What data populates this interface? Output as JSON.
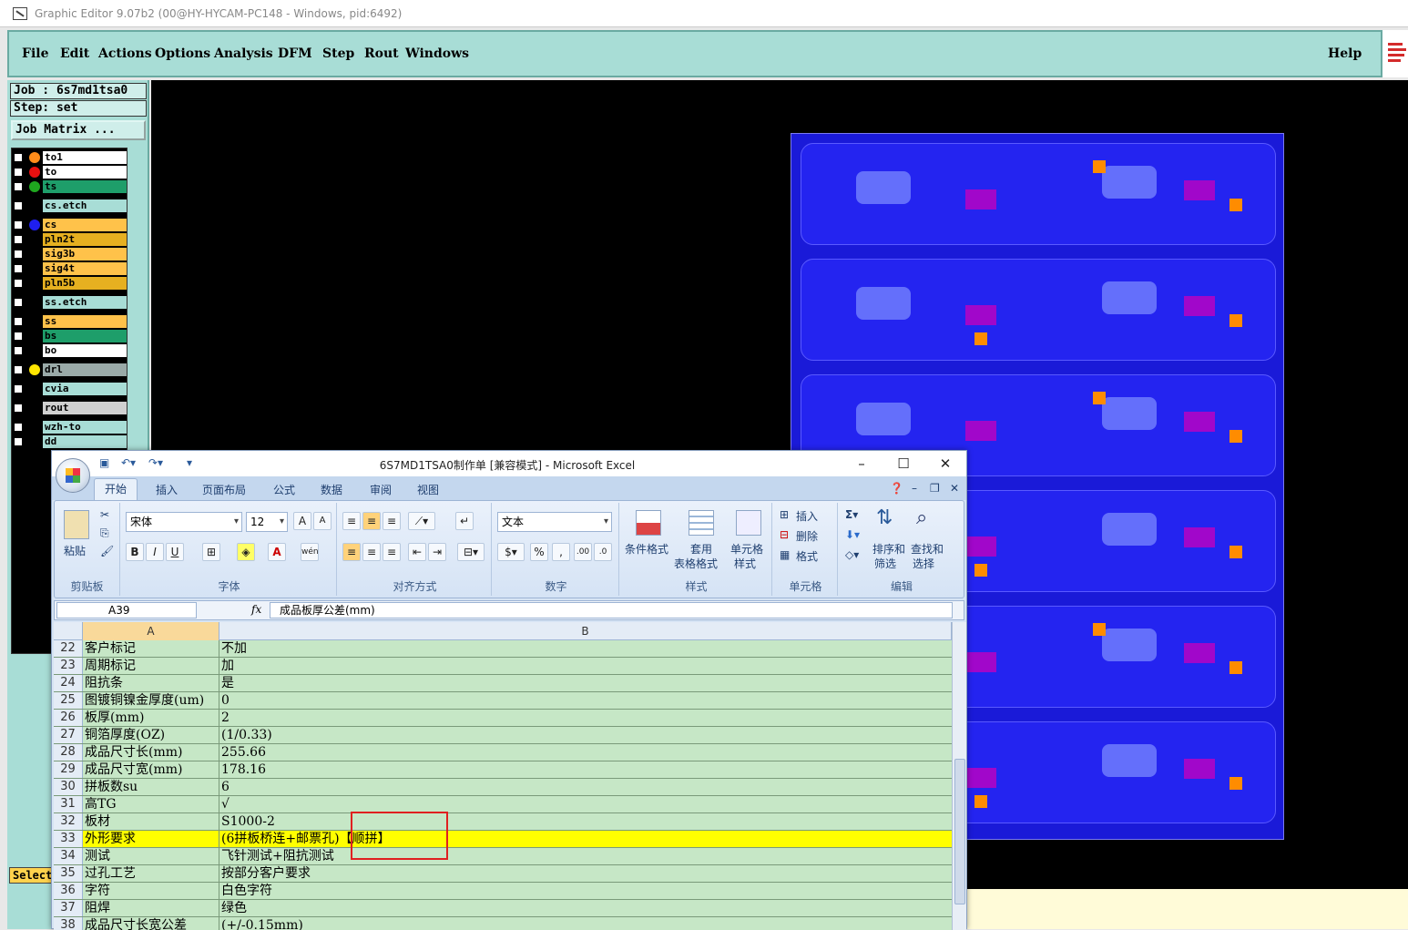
{
  "editor": {
    "title": "Graphic Editor 9.07b2 (00@HY-HYCAM-PC148 - Windows, pid:6492)",
    "menu": [
      "File",
      "Edit",
      "Actions",
      "Options",
      "Analysis",
      "DFM",
      "Step",
      "Rout",
      "Windows"
    ],
    "help": "Help",
    "job": "Job : 6s7md1tsa0",
    "step": "Step: set",
    "job_matrix": "Job Matrix ...",
    "select": "Select",
    "layers": [
      {
        "name": "to1",
        "dot": "#ff8c1a",
        "bg": "#ffffff"
      },
      {
        "name": "to",
        "dot": "#e81010",
        "bg": "#ffffff"
      },
      {
        "name": "ts",
        "dot": "#1fa81f",
        "bg": "#1e9e6a"
      },
      {
        "name": "cs.etch",
        "dot": "",
        "bg": "#a8ddd6"
      },
      {
        "name": "cs",
        "dot": "#1f1ff0",
        "bg": "#ffc24a"
      },
      {
        "name": "pln2t",
        "dot": "",
        "bg": "#e6b020"
      },
      {
        "name": "sig3b",
        "dot": "",
        "bg": "#ffc24a"
      },
      {
        "name": "sig4t",
        "dot": "",
        "bg": "#ffc24a"
      },
      {
        "name": "pln5b",
        "dot": "",
        "bg": "#e6b020"
      },
      {
        "name": "ss.etch",
        "dot": "",
        "bg": "#a8ddd6"
      },
      {
        "name": "ss",
        "dot": "",
        "bg": "#ffc24a"
      },
      {
        "name": "bs",
        "dot": "",
        "bg": "#1e9e6a"
      },
      {
        "name": "bo",
        "dot": "",
        "bg": "#ffffff"
      },
      {
        "name": "drl",
        "dot": "#ffe600",
        "bg": "#9aaaa8"
      },
      {
        "name": "cvia",
        "dot": "",
        "bg": "#a8ddd6"
      },
      {
        "name": "rout",
        "dot": "",
        "bg": "#d0d0d0"
      },
      {
        "name": "wzh-to",
        "dot": "",
        "bg": "#a8ddd6"
      },
      {
        "name": "dd",
        "dot": "",
        "bg": "#a8ddd6"
      }
    ],
    "colors": {
      "panel": "#a8ddd6",
      "canvas": "#000000",
      "pcb": "#1a1ad8"
    }
  },
  "excel": {
    "title": "6S7MD1TSA0制作单 [兼容模式] - Microsoft Excel",
    "tabs": [
      "开始",
      "插入",
      "页面布局",
      "公式",
      "数据",
      "审阅",
      "视图"
    ],
    "groups": {
      "clipboard": "剪贴板",
      "font": "字体",
      "align": "对齐方式",
      "number": "数字",
      "style": "样式",
      "cells": "单元格",
      "edit": "编辑"
    },
    "paste": "粘贴",
    "font_name": "宋体",
    "font_size": "12",
    "number_format": "文本",
    "cond_format": "条件格式",
    "table_format": [
      "套用",
      "表格格式"
    ],
    "cell_style": [
      "单元格",
      "样式"
    ],
    "insert": "插入",
    "delete": "删除",
    "format": "格式",
    "sort": [
      "排序和",
      "筛选"
    ],
    "find": [
      "查找和",
      "选择"
    ],
    "name_box": "A39",
    "fx": "fx",
    "formula": "成品板厚公差(mm)",
    "col_a": "A",
    "col_b": "B",
    "rows": [
      {
        "n": "22",
        "a": "客户标记",
        "b": "不加"
      },
      {
        "n": "23",
        "a": "周期标记",
        "b": "加"
      },
      {
        "n": "24",
        "a": "阻抗条",
        "b": "是"
      },
      {
        "n": "25",
        "a": "图镀铜镍金厚度(um)",
        "b": "0"
      },
      {
        "n": "26",
        "a": "板厚(mm)",
        "b": "2"
      },
      {
        "n": "27",
        "a": "铜箔厚度(OZ)",
        "b": "(1/0.33)"
      },
      {
        "n": "28",
        "a": "成品尺寸长(mm)",
        "b": "255.66"
      },
      {
        "n": "29",
        "a": "成品尺寸宽(mm)",
        "b": "178.16"
      },
      {
        "n": "30",
        "a": "拼板数su",
        "b": "6"
      },
      {
        "n": "31",
        "a": "高TG",
        "b": "√"
      },
      {
        "n": "32",
        "a": "板材",
        "b": "S1000-2"
      },
      {
        "n": "33",
        "a": "外形要求",
        "b": "(6拼板桥连+邮票孔)【顺拼】"
      },
      {
        "n": "34",
        "a": "测试",
        "b": "飞针测试+阻抗测试"
      },
      {
        "n": "35",
        "a": "过孔工艺",
        "b": "按部分客户要求"
      },
      {
        "n": "36",
        "a": "字符",
        "b": "白色字符"
      },
      {
        "n": "37",
        "a": "阻焊",
        "b": "绿色"
      },
      {
        "n": "38",
        "a": "成品尺寸长宽公差",
        "b": "(+/-0.15mm)"
      }
    ],
    "highlight_row": "33",
    "colors": {
      "cell_bg": "#c6e7c6",
      "highlight": "#ffff00",
      "annotation": "#e02020"
    }
  }
}
